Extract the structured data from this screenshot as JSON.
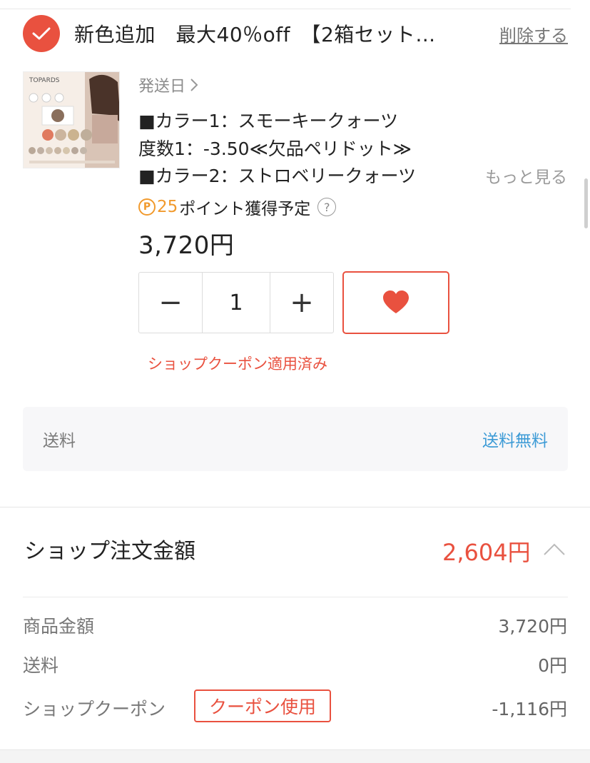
{
  "item": {
    "title": "新色追加　最大40％off　【2箱セット…",
    "delete_label": "削除する",
    "image_alt": "TOPARDS",
    "ship_date_label": "発送日",
    "specs": [
      "■カラー1：スモーキークォーツ",
      "度数1：-3.50≪欠品ペリドット≫",
      "■カラー2：ストロベリークォーツ"
    ],
    "more_label": "もっと見る",
    "points": {
      "badge": "P",
      "value": "25",
      "label": "ポイント獲得予定",
      "help": "?"
    },
    "price": "3,720円",
    "quantity": {
      "decrement": "−",
      "value": "1",
      "increment": "+"
    },
    "coupon_applied": "ショップクーポン適用済み"
  },
  "shipping": {
    "label": "送料",
    "value": "送料無料"
  },
  "summary": {
    "title": "ショップ注文金額",
    "total": "2,604円",
    "lines": [
      {
        "label": "商品金額",
        "value": "3,720円"
      },
      {
        "label": "送料",
        "value": "0円"
      },
      {
        "label": "ショップクーポン",
        "value": "-1,116円"
      }
    ],
    "coupon_button": "クーポン使用"
  },
  "colors": {
    "accent": "#e9513f",
    "link": "#3d9bd6",
    "points": "#f19a2d"
  },
  "icons": {
    "check": "check-icon",
    "chevron_right": "chevron-right-icon",
    "heart": "heart-icon",
    "help": "help-icon",
    "chevron_up": "chevron-up-icon"
  }
}
